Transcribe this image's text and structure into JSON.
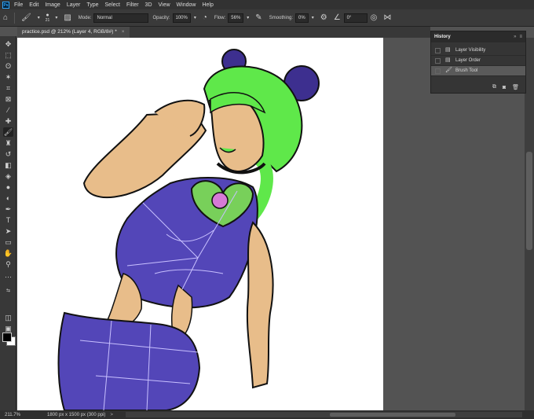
{
  "menubar": {
    "logo": "Ps",
    "items": [
      "File",
      "Edit",
      "Image",
      "Layer",
      "Type",
      "Select",
      "Filter",
      "3D",
      "View",
      "Window",
      "Help"
    ]
  },
  "options": {
    "brush_size": "21",
    "mode_label": "Mode:",
    "mode_value": "Normal",
    "opacity_label": "Opacity:",
    "opacity_value": "100%",
    "flow_label": "Flow:",
    "flow_value": "56%",
    "smoothing_label": "Smoothing:",
    "smoothing_value": "0%",
    "angle_value": "0°"
  },
  "document": {
    "tab_title": "practice.psd @ 212% (Layer 4, RGB/8#) *",
    "close_glyph": "×"
  },
  "history": {
    "title": "History",
    "collapse_glyph": "»",
    "menu_glyph": "≡",
    "items": [
      {
        "label": "Layer Visibility",
        "active": false
      },
      {
        "label": "Layer Order",
        "active": false
      },
      {
        "label": "Brush Tool",
        "active": true
      }
    ]
  },
  "status": {
    "zoom": "211.7%",
    "doc_info": "1800 px x 1500 px (300 ppi)",
    "arrow": ">"
  },
  "colors": {
    "ui_dark": "#323232",
    "panel": "#383838",
    "canvas_bg": "#535353"
  }
}
